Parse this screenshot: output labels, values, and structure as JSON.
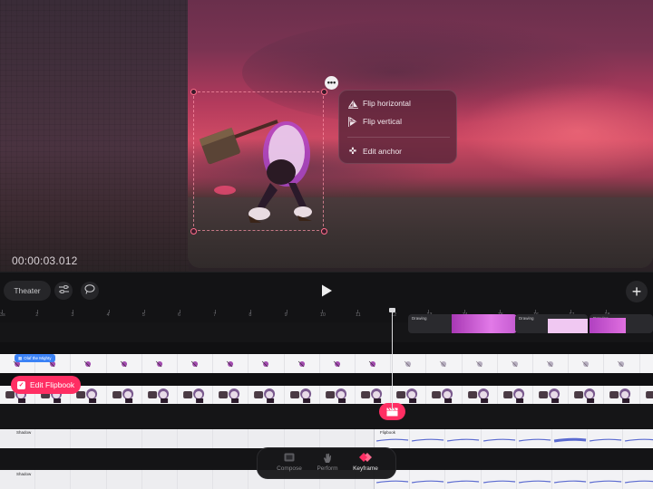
{
  "preview": {
    "timecode": "00:00:03.012"
  },
  "context_menu": {
    "items": [
      {
        "label": "Flip horizontal",
        "icon": "flip-horizontal-icon"
      },
      {
        "label": "Flip vertical",
        "icon": "flip-vertical-icon"
      },
      {
        "label": "Edit anchor",
        "icon": "anchor-icon"
      }
    ]
  },
  "toolbar": {
    "theater_label": "Theater"
  },
  "timeline": {
    "ruler_labels": [
      "3s",
      "2",
      "3",
      "4",
      "5",
      "6",
      "7",
      "8",
      "9",
      "10",
      "11",
      "12",
      "13",
      "14",
      "15",
      "16",
      "17",
      "18"
    ],
    "drawing_labels": [
      "Drawing",
      "Drawing",
      "Drawing"
    ],
    "character_tag": "Olaf the Mighty",
    "edit_flipbook_label": "Edit Flipbook",
    "shadow_labels": [
      "Shadow",
      "Shadow"
    ],
    "flipbook_label": "Flipbook"
  },
  "modes": {
    "items": [
      {
        "label": "Compose",
        "icon": "compose-icon"
      },
      {
        "label": "Perform",
        "icon": "hand-icon"
      },
      {
        "label": "Keyframe",
        "icon": "keyframe-icon"
      }
    ],
    "active": "Keyframe"
  },
  "colors": {
    "accent": "#ff2e63",
    "blue_tag": "#3b82f6",
    "clip_purple": "#d05ad8"
  }
}
